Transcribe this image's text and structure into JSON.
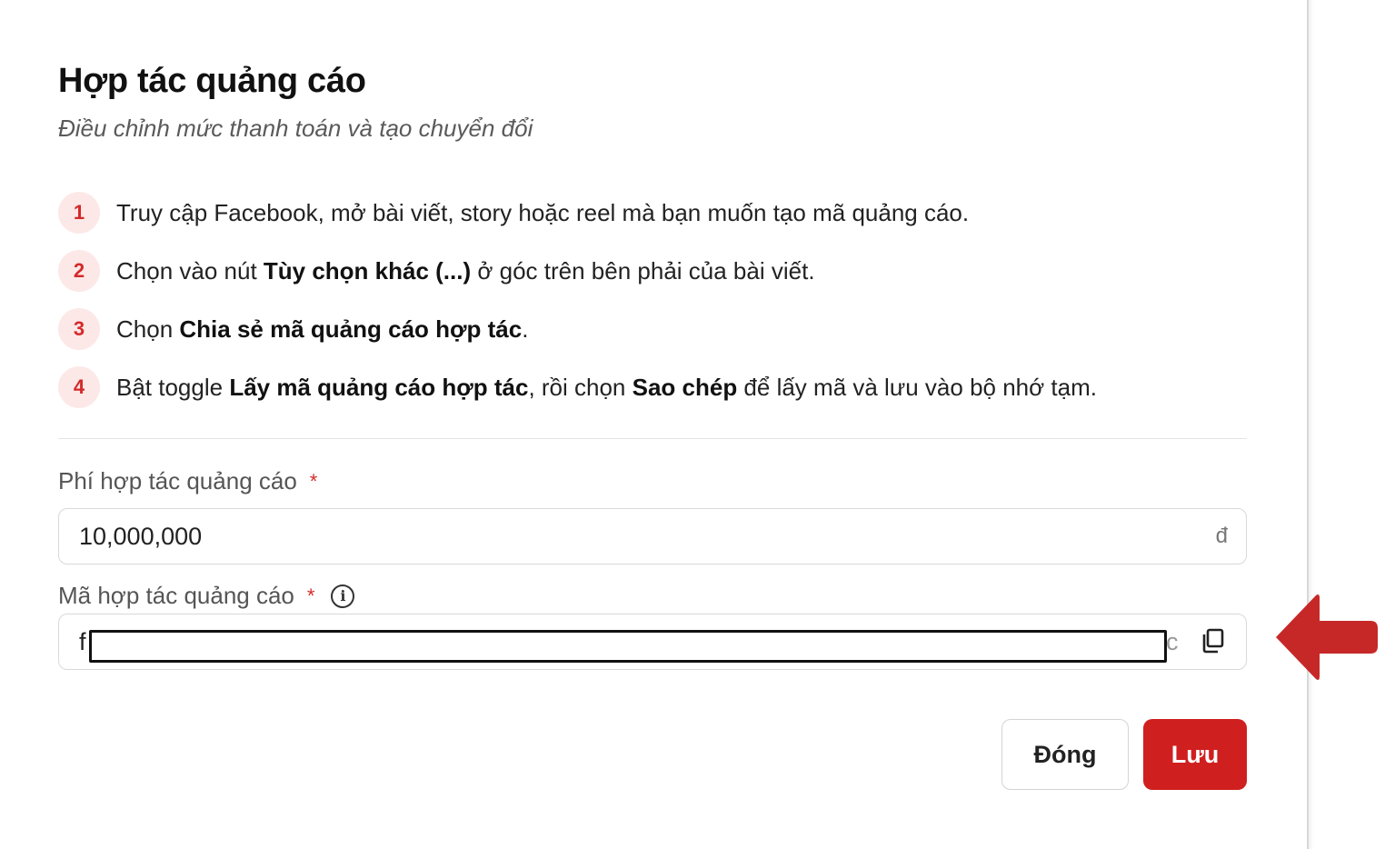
{
  "modal": {
    "title": "Hợp tác quảng cáo",
    "subtitle": "Điều chỉnh mức thanh toán và tạo chuyển đổi"
  },
  "steps": [
    {
      "num": "1",
      "parts": [
        {
          "t": "Truy cập Facebook, mở bài viết, story hoặc reel mà bạn muốn tạo mã quảng cáo.",
          "b": false
        }
      ]
    },
    {
      "num": "2",
      "parts": [
        {
          "t": "Chọn vào nút ",
          "b": false
        },
        {
          "t": "Tùy chọn khác (...)",
          "b": true
        },
        {
          "t": " ở góc trên bên phải của bài viết.",
          "b": false
        }
      ]
    },
    {
      "num": "3",
      "parts": [
        {
          "t": "Chọn ",
          "b": false
        },
        {
          "t": "Chia sẻ mã quảng cáo hợp tác",
          "b": true
        },
        {
          "t": ".",
          "b": false
        }
      ]
    },
    {
      "num": "4",
      "parts": [
        {
          "t": "Bật toggle ",
          "b": false
        },
        {
          "t": "Lấy mã quảng cáo hợp tác",
          "b": true
        },
        {
          "t": ", rồi chọn ",
          "b": false
        },
        {
          "t": "Sao chép",
          "b": true
        },
        {
          "t": " để lấy mã và lưu vào bộ nhớ tạm.",
          "b": false
        }
      ]
    }
  ],
  "fee_field": {
    "label": "Phí hợp tác quảng cáo",
    "required_mark": "*",
    "value": "10,000,000",
    "suffix": "đ"
  },
  "code_field": {
    "label": "Mã hợp tác quảng cáo",
    "required_mark": "*",
    "visible_prefix": "f",
    "visible_suffix": "c",
    "value_redacted": true
  },
  "buttons": {
    "close_label": "Đóng",
    "save_label": "Lưu"
  },
  "colors": {
    "accent": "#d01f1f",
    "step_badge_bg": "#fde8e8",
    "annotation_arrow": "#c62828"
  },
  "icons": [
    "info-icon",
    "copy-icon",
    "red-arrow-annotation-icon"
  ]
}
